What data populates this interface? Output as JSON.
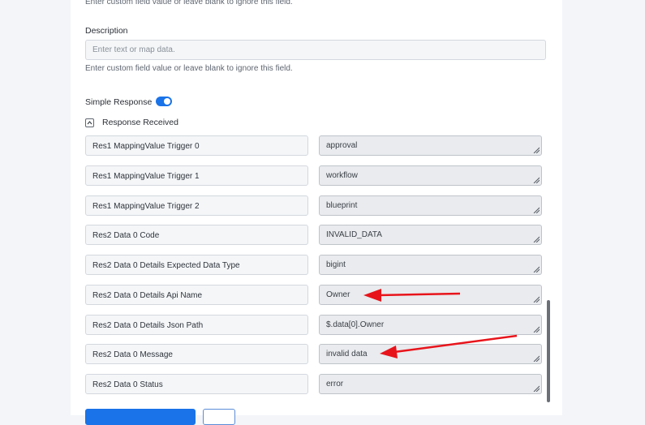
{
  "custom_field_hint_top": "Enter custom field value or leave blank to ignore this field.",
  "description": {
    "label": "Description",
    "placeholder": "Enter text or map data.",
    "hint": "Enter custom field value or leave blank to ignore this field."
  },
  "simple_response": {
    "label": "Simple Response",
    "enabled": true
  },
  "response_received": {
    "label": "Response Received",
    "rows": [
      {
        "key": "Res1 MappingValue Trigger 0",
        "value": "approval"
      },
      {
        "key": "Res1 MappingValue Trigger 1",
        "value": "workflow"
      },
      {
        "key": "Res1 MappingValue Trigger 2",
        "value": "blueprint"
      },
      {
        "key": "Res2 Data 0 Code",
        "value": "INVALID_DATA"
      },
      {
        "key": "Res2 Data 0 Details Expected Data Type",
        "value": "bigint"
      },
      {
        "key": "Res2 Data 0 Details Api Name",
        "value": "Owner"
      },
      {
        "key": "Res2 Data 0 Details Json Path",
        "value": "$.data[0].Owner"
      },
      {
        "key": "Res2 Data 0 Message",
        "value": "invalid data"
      },
      {
        "key": "Res2 Data 0 Status",
        "value": "error"
      }
    ]
  },
  "icons": {
    "collapse": "chevron-up-icon",
    "resize": "resize-grip-icon",
    "annotation": "red-arrow-icon"
  },
  "colors": {
    "accent": "#1a73e8",
    "annotation_arrow": "#e8141b",
    "page_background": "#f3f5f8"
  }
}
